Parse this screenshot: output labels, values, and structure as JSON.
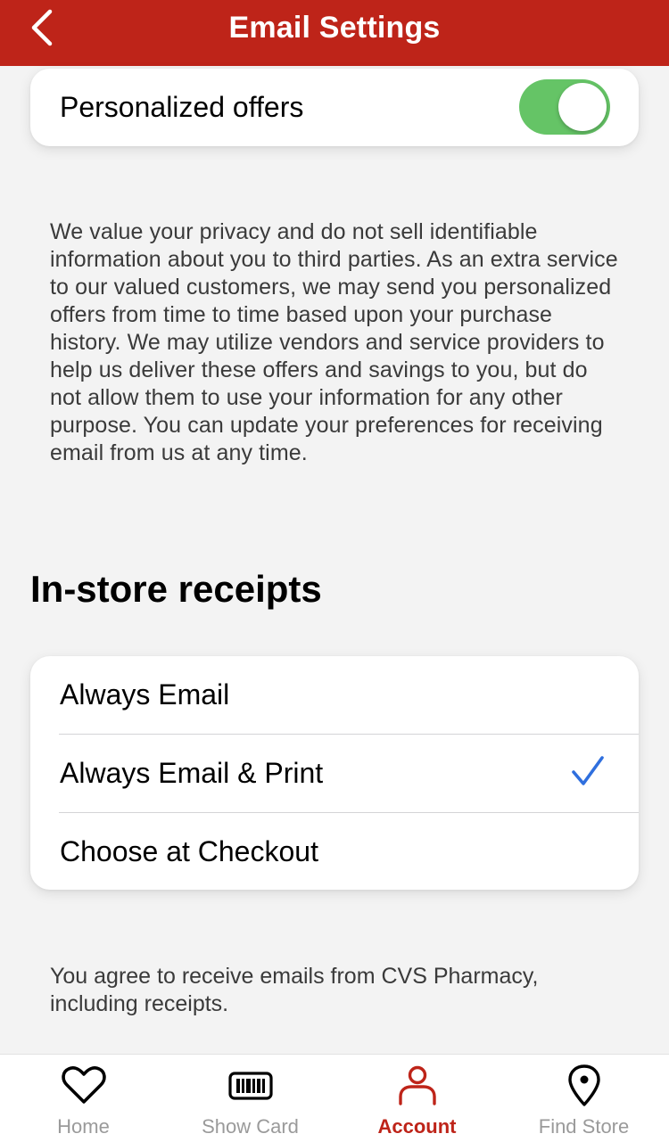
{
  "header": {
    "title": "Email Settings",
    "back_icon": "chevron-left-icon",
    "background": "#be2419"
  },
  "offers": {
    "label": "Personalized offers",
    "enabled": true,
    "toggle_color": "#65c466"
  },
  "privacy_text": "We value your privacy and do not sell identifiable information about you to third parties. As an extra service to our valued customers, we may send you personalized offers from time to time based upon your purchase history. We may utilize vendors and service providers to help us deliver these offers and savings to you, but do not allow them to use your information for any other purpose. You can update your preferences for receiving email from us at any time.",
  "receipts": {
    "heading": "In-store receipts",
    "options": [
      {
        "label": "Always Email",
        "selected": false
      },
      {
        "label": "Always Email & Print",
        "selected": true
      },
      {
        "label": "Choose at Checkout",
        "selected": false
      }
    ],
    "check_color": "#2f6fde"
  },
  "agree_text": "You agree to receive emails from CVS Pharmacy, including receipts.",
  "tabs": [
    {
      "label": "Home",
      "icon": "heart-icon",
      "active": false
    },
    {
      "label": "Show Card",
      "icon": "barcode-card-icon",
      "active": false
    },
    {
      "label": "Account",
      "icon": "person-icon",
      "active": true
    },
    {
      "label": "Find Store",
      "icon": "location-pin-icon",
      "active": false
    }
  ],
  "colors": {
    "active_tab": "#be2419",
    "inactive_tab": "#9a9a9a"
  }
}
